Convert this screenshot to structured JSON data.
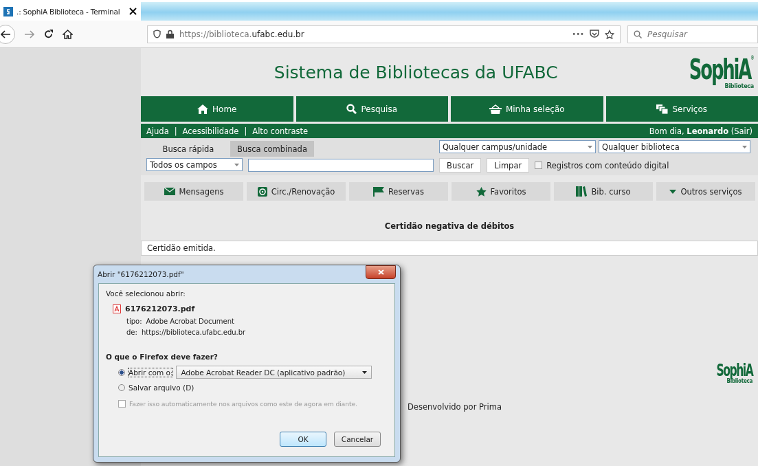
{
  "browser": {
    "tab": {
      "title": ".: SophiA Biblioteca - Terminal",
      "selected": true
    },
    "url_prefix": "https://biblioteca.",
    "url_domain": "ufabc.edu.br",
    "menu_glyph": "•••",
    "search_placeholder": "Pesquisar"
  },
  "header": {
    "title": "Sistema de Bibliotecas da UFABC",
    "logo": "SophiA",
    "logo_mark": "®",
    "logo_sub": "Biblioteca"
  },
  "nav": [
    {
      "label": "Home"
    },
    {
      "label": "Pesquisa"
    },
    {
      "label": "Minha seleção"
    },
    {
      "label": "Serviços"
    }
  ],
  "links": [
    "Ajuda",
    "Acessibilidade",
    "Alto contraste"
  ],
  "link_separator": "|",
  "greeting": "Bom dia, **Leonardo** (Sair)",
  "search": {
    "tabs": [
      {
        "label": "Busca rápida",
        "selected": true
      },
      {
        "label": "Busca combinada",
        "selected": false
      }
    ],
    "campus": "Qualquer campus/unidade",
    "library": "Qualquer biblioteca",
    "field": "Todos os campos",
    "buttons": [
      "Buscar",
      "Limpar"
    ],
    "digital": {
      "label": "Registros com conteúdo digital",
      "checked": false
    }
  },
  "services": [
    {
      "label": "Mensagens"
    },
    {
      "label": "Circ./Renovação"
    },
    {
      "label": "Reservas"
    },
    {
      "label": "Favoritos"
    },
    {
      "label": "Bib. curso"
    },
    {
      "label": "Outros serviços"
    }
  ],
  "page_title": "Certidão negativa de débitos",
  "message": "Certidão emitida.",
  "footer": {
    "logo": "SophiA",
    "logo_sub": "Biblioteca",
    "credit": "Desenvolvido por Prima"
  },
  "dialog": {
    "title": "Abrir \"6176212073.pdf\"",
    "intro": "Você selecionou abrir:",
    "file": "6176212073.pdf",
    "type_label": "tipo:",
    "type": "Adobe Acrobat Document",
    "from_label": "de:",
    "from": "https://biblioteca.ufabc.edu.br",
    "question": "O que o Firefox deve fazer?",
    "options": [
      {
        "kind": "open",
        "label": "Abrir com o:",
        "selected": true,
        "app": "Adobe Acrobat Reader DC  (aplicativo padrão)"
      },
      {
        "kind": "save",
        "label": "Salvar arquivo (D)",
        "selected": false
      }
    ],
    "remember": {
      "label": "Fazer isso automaticamente nos arquivos como este de agora em diante.",
      "checked": false,
      "disabled": true
    },
    "buttons": [
      {
        "label": "OK",
        "default": true
      },
      {
        "label": "Cancelar",
        "default": false
      }
    ]
  }
}
